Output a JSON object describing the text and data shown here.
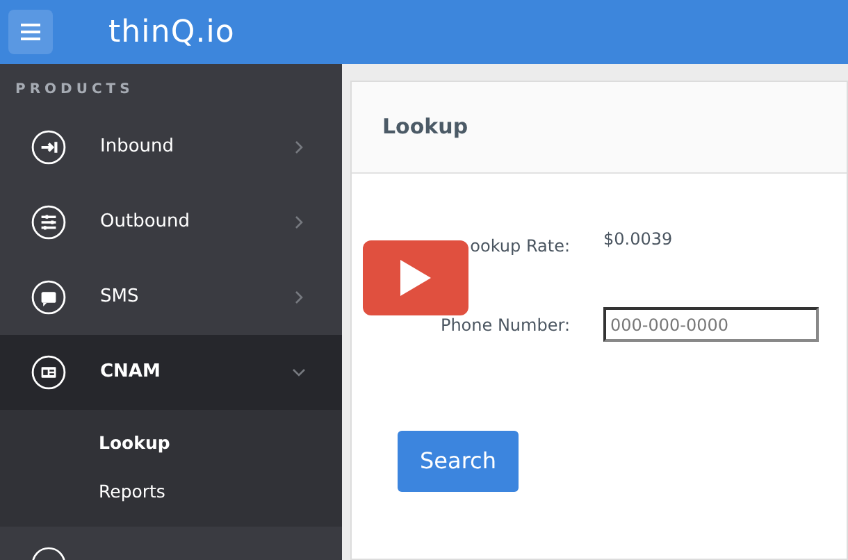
{
  "header": {
    "logo": "thinQ.io"
  },
  "sidebar": {
    "heading": "PRODUCTS",
    "items": [
      {
        "label": "Inbound",
        "expanded": false
      },
      {
        "label": "Outbound",
        "expanded": false
      },
      {
        "label": "SMS",
        "expanded": false
      },
      {
        "label": "CNAM",
        "expanded": true,
        "children": [
          {
            "label": "Lookup",
            "selected": true
          },
          {
            "label": "Reports",
            "selected": false
          }
        ]
      }
    ]
  },
  "panel": {
    "title": "Lookup",
    "rate_label": "ookup Rate:",
    "rate_value": "$0.0039",
    "phone_label": "Phone Number:",
    "phone_placeholder": "000-000-0000",
    "button": "Search"
  }
}
